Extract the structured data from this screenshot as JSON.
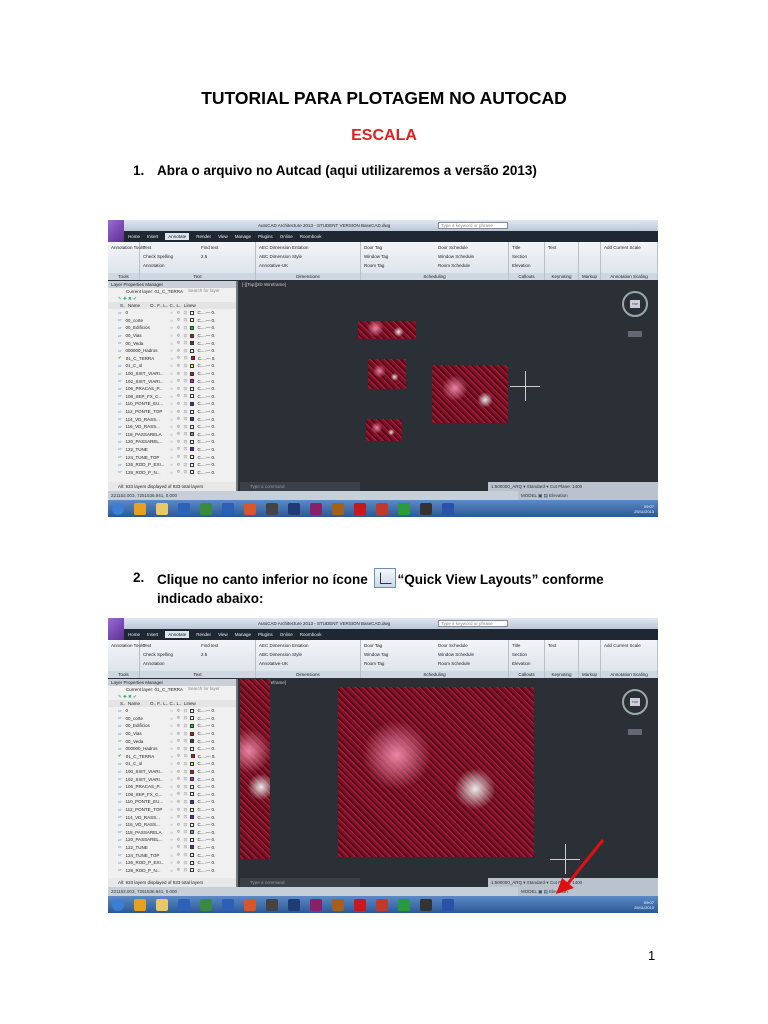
{
  "title": "TUTORIAL PARA PLOTAGEM NO AUTOCAD",
  "subtitle": "ESCALA",
  "steps": [
    {
      "number": "1.",
      "text": "Abra o arquivo no Autcad (aqui utilizaremos a versão 2013)"
    },
    {
      "number": "2.",
      "text_before": "Clique no canto inferior no ícone",
      "text_after": "“Quick View Layouts” conforme indicado abaixo:",
      "icon": "quick-view-layouts-icon"
    }
  ],
  "page_number": "1",
  "autocad": {
    "window_title": "AutoCAD Architecture 2013 - STUDENT VERSION   BaseCAD.dwg",
    "search_placeholder": "Type a keyword or phrase",
    "tabs": [
      "Home",
      "Insert",
      "Annotate",
      "Render",
      "View",
      "Manage",
      "Plugins",
      "Online",
      "Roombook"
    ],
    "active_tab": "Annotate",
    "panels": [
      {
        "label": "Tools",
        "items": [
          "Annotation Tools"
        ]
      },
      {
        "label": "Text",
        "items": [
          "Text",
          "Check Spelling",
          "Annotation",
          "Find text",
          "2.5"
        ]
      },
      {
        "label": "Dimensions",
        "items": [
          "AEC Dimension Entation",
          "ABC Dimension Style",
          "Annotative-UK"
        ]
      },
      {
        "label": "Scheduling",
        "items": [
          "Door Tag",
          "Window Tag",
          "Room Tag",
          "Door Schedule",
          "Window Schedule",
          "Room Schedule"
        ]
      },
      {
        "label": "Callouts",
        "items": [
          "Title",
          "Section",
          "Elevation"
        ]
      },
      {
        "label": "Keynoting",
        "items": [
          "Text"
        ]
      },
      {
        "label": "Markup",
        "items": []
      },
      {
        "label": "Annotation Scaling",
        "items": [
          "Add Current Scale"
        ]
      }
    ],
    "layer_manager": {
      "title": "Layer Properties Manager",
      "current_layer": "Current layer: 01_C_TERRA",
      "search_placeholder": "Search for layer",
      "columns": "S..  Name        O.. F.. L.. C.. L..  Linew",
      "layers": [
        {
          "name": "0",
          "color": "#ffffff"
        },
        {
          "name": "00_corte",
          "color": "#ffffff"
        },
        {
          "name": "00_Edificios",
          "color": "#22cc22"
        },
        {
          "name": "00_Vias",
          "color": "#dd1111"
        },
        {
          "name": "00_Veda",
          "color": "#444444"
        },
        {
          "name": "000000_Hadros",
          "color": "#ffffff"
        },
        {
          "name": "01_C_TERRA",
          "color": "#dd1111",
          "current": true
        },
        {
          "name": "01_C_ol",
          "color": "#eeee22"
        },
        {
          "name": "100_SIST_VIARI...",
          "color": "#dd1111"
        },
        {
          "name": "102_SIST_VIARI...",
          "color": "#dd22dd"
        },
        {
          "name": "106_PRACAS_P...",
          "color": "#ffffff"
        },
        {
          "name": "108_SEP_FX_C...",
          "color": "#ffffff"
        },
        {
          "name": "110_PONTE_EU...",
          "color": "#5522cc"
        },
        {
          "name": "112_PONTE_TOP",
          "color": "#ffffff"
        },
        {
          "name": "114_VD_RASS...",
          "color": "#6622cc"
        },
        {
          "name": "116_VD_RASS...",
          "color": "#ffffff"
        },
        {
          "name": "118_PASSARELA",
          "color": "#999999"
        },
        {
          "name": "120_PASSAREL...",
          "color": "#ffffff"
        },
        {
          "name": "122_TUNE",
          "color": "#6622cc"
        },
        {
          "name": "124_TUNE_TOP",
          "color": "#ffffff"
        },
        {
          "name": "126_ROD_P_EXI...",
          "color": "#ffffff"
        },
        {
          "name": "128_ROD_P_N...",
          "color": "#ffffff"
        }
      ],
      "footer": "All: 933 layers displayed of 933 total layers"
    },
    "viewport_label": "[-][Top][2D Wireframe]",
    "command_placeholder": "Type a command",
    "coordinates": "221153.003, 7251536.941, 0.000",
    "model_label": "MODEL",
    "annotation_scale": "1:500000_ARQ",
    "style": "Standard",
    "cut_plane": "Cut Plane: 1400",
    "elevation": "Elevation",
    "clock_time": "09:07",
    "clock_date": "25/11/2013",
    "annotation_arrow_color": "#e01010"
  }
}
